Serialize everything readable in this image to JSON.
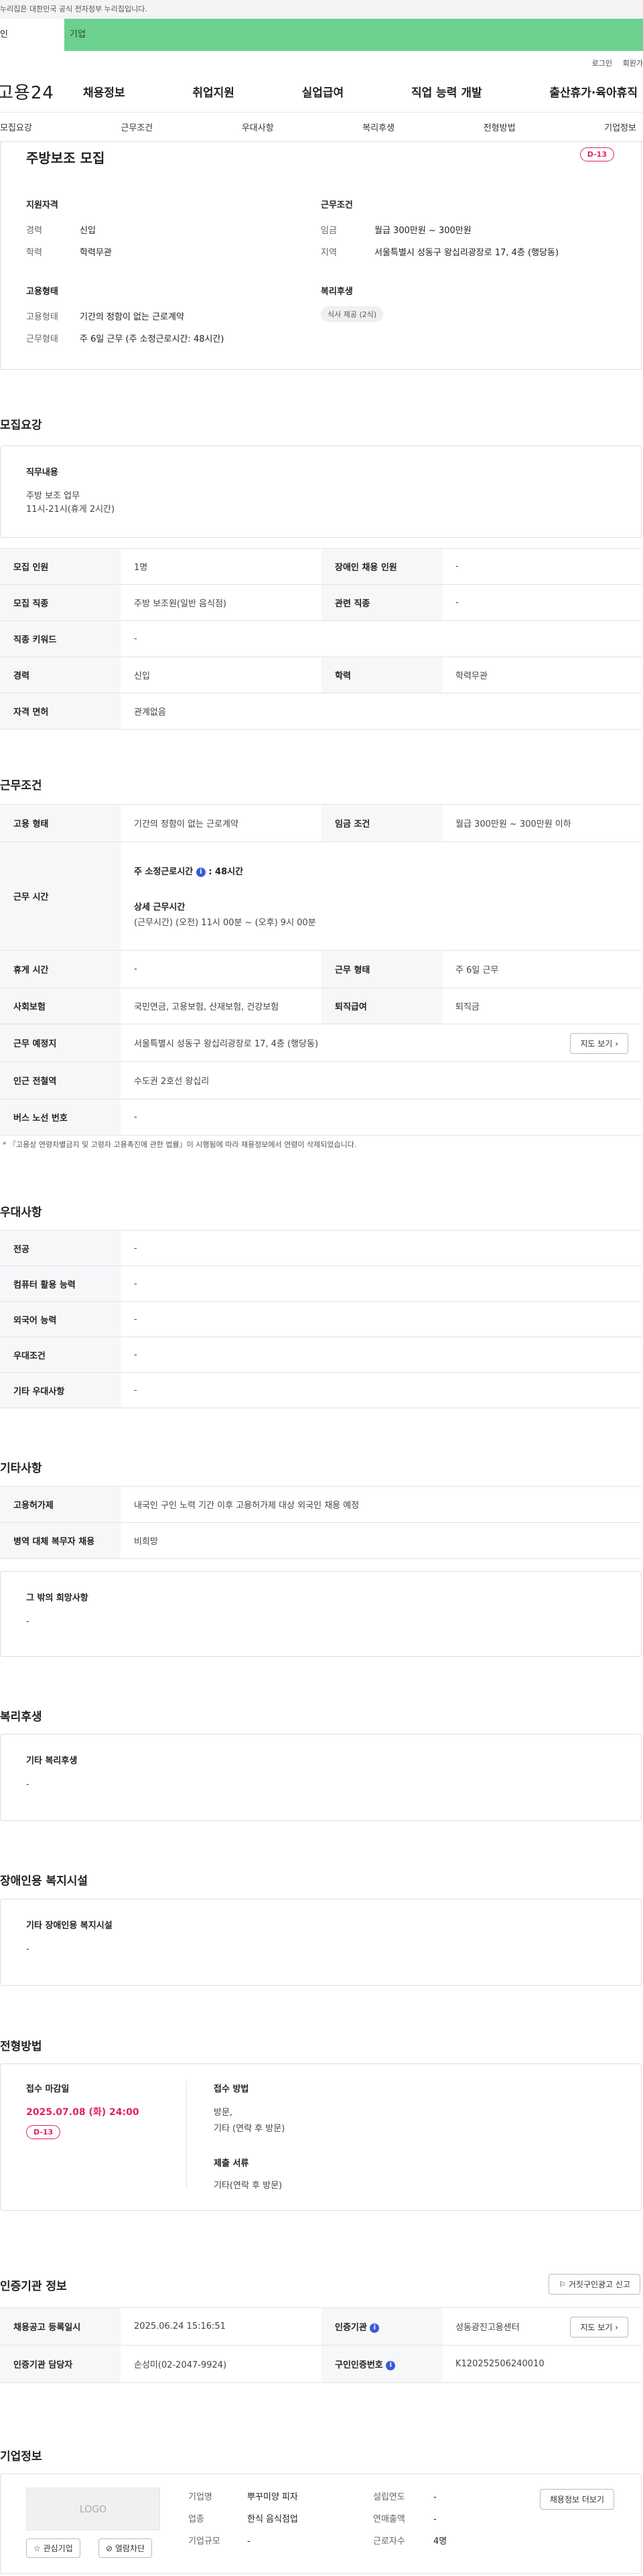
{
  "gov_banner": "누리집은 대한민국 공식 전자정부 누리집입니다.",
  "persona": {
    "individual": "인",
    "company": "기업"
  },
  "util": {
    "login": "로그인",
    "join": "회원가"
  },
  "gnb": {
    "logo": "고용24",
    "menu": [
      "채용정보",
      "취업지원",
      "실업급여",
      "직업 능력 개발",
      "출산휴가·육아휴직"
    ]
  },
  "tabs": [
    "모집요강",
    "근무조건",
    "우대사항",
    "복리후생",
    "전형방법",
    "기업정보"
  ],
  "summary": {
    "title": "주방보조 모집",
    "dday": "D-13",
    "qual_title": "지원자격",
    "qual": [
      {
        "k": "경력",
        "v": "신입"
      },
      {
        "k": "학력",
        "v": "학력무관"
      }
    ],
    "cond_title": "근무조건",
    "cond": [
      {
        "k": "임금",
        "v": "월급 300만원 ~ 300만원"
      },
      {
        "k": "지역",
        "v": "서울특별시 성동구 왕십리광장로 17, 4층 (행당동)"
      }
    ],
    "emp_title": "고용형태",
    "emp": [
      {
        "k": "고용형태",
        "v": "기간의 정함이 없는 근로계약"
      },
      {
        "k": "근무형태",
        "v": "주 6일 근무 (주 소정근로시간: 48시간)"
      }
    ],
    "welfare_title": "복리후생",
    "welfare_chip": "식사 제공 (2식)"
  },
  "recruit": {
    "title": "모집요강",
    "duty_title": "직무내용",
    "duty_lines": [
      "주방 보조 업무",
      "11시-21시(휴게 2시간)"
    ],
    "rows": {
      "count_k": "모집 인원",
      "count_v": "1명",
      "disabled_k": "장애인 채용 인원",
      "disabled_v": "-",
      "job_k": "모집 직종",
      "job_v": "주방 보조원(일반 음식점)",
      "related_k": "관련 직종",
      "related_v": "-",
      "kw_k": "직종 키워드",
      "kw_v": "-",
      "career_k": "경력",
      "career_v": "신입",
      "edu_k": "학력",
      "edu_v": "학력무관",
      "license_k": "자격 면허",
      "license_v": "관계없음"
    }
  },
  "work": {
    "title": "근무조건",
    "type_k": "고용 형태",
    "type_v": "기간의 정함이 없는 근로계약",
    "wage_k": "임금 조건",
    "wage_v": "월급 300만원 ~ 300만원 이하",
    "hours_k": "근무 시간",
    "hours_weekly": "주 소정근로시간",
    "hours_weekly_val": ": 48시간",
    "hours_detail_title": "상세 근무시간",
    "hours_detail": "(근무시간) (오전) 11시 00분 ~ (오후) 9시 00분",
    "rest_k": "휴게 시간",
    "rest_v": "-",
    "form_k": "근무 형태",
    "form_v": "주 6일 근무",
    "ins_k": "사회보험",
    "ins_v": "국민연금, 고용보험, 산재보험, 건강보험",
    "sev_k": "퇴직급여",
    "sev_v": "퇴직금",
    "place_k": "근무 예정지",
    "place_v": "서울특별시 성동구 왕십리광장로 17, 4층 (행당동)",
    "map_btn": "지도 보기",
    "subway_k": "인근 전철역",
    "subway_v": "수도권 2호선 왕십리",
    "bus_k": "버스 노선 번호",
    "bus_v": "-",
    "notice": "* 『고용상 연령차별금지 및 고령자 고용촉진에 관한 법률』이 시행됨에 따라 채용정보에서 연령이 삭제되었습니다."
  },
  "pref": {
    "title": "우대사항",
    "rows": [
      {
        "k": "전공",
        "v": "-"
      },
      {
        "k": "컴퓨터 활용 능력",
        "v": "-"
      },
      {
        "k": "외국어 능력",
        "v": "-"
      },
      {
        "k": "우대조건",
        "v": "-"
      },
      {
        "k": "기타 우대사항",
        "v": "-"
      }
    ]
  },
  "etc": {
    "title": "기타사항",
    "rows": [
      {
        "k": "고용허가제",
        "v": "내국인 구인 노력 기간 이후 고용허가제 대상 외국인 채용 예정"
      },
      {
        "k": "병역 대체 복무자 채용",
        "v": "비희망"
      }
    ],
    "other_title": "그 밖의 희망사항",
    "other_v": "-"
  },
  "welfare": {
    "title": "복리후생",
    "box_title": "기타 복리후생",
    "box_v": "-"
  },
  "facility": {
    "title": "장애인용 복지시설",
    "box_title": "기타 장애인용 복지시설",
    "box_v": "-"
  },
  "process": {
    "title": "전형방법",
    "deadline_title": "접수 마감일",
    "deadline": "2025.07.08 (화) 24:00",
    "dday": "D-13",
    "method_title": "접수 방법",
    "method_lines": [
      "방문,",
      "기타 (연락 후 방문)"
    ],
    "docs_title": "제출 서류",
    "docs": "기타(연락 후 방문)"
  },
  "cert": {
    "title": "인증기관 정보",
    "report_btn": "거짓구인광고 신고",
    "reg_k": "채용공고 등록일시",
    "reg_v": "2025.06.24 15:16:51",
    "org_k": "인증기관",
    "org_v": "성동광진고용센터",
    "map_btn": "지도 보기",
    "mgr_k": "인증기관 담당자",
    "mgr_v": "손성미(02-2047-9924)",
    "num_k": "구인인증번호",
    "num_v": "K120252506240010"
  },
  "company": {
    "title": "기업정보",
    "logo": "LOGO",
    "fav_btn": "관심기업",
    "block_btn": "열람차단",
    "name_k": "기업명",
    "name_v": "뿌꾸미양 피자",
    "year_k": "설립연도",
    "year_v": "-",
    "ind_k": "업종",
    "ind_v": "한식 음식점업",
    "sales_k": "연매출액",
    "sales_v": "-",
    "size_k": "기업규모",
    "size_v": "-",
    "emp_k": "근로자수",
    "emp_v": "4명",
    "jobs_btn": "채용정보 더보기"
  },
  "colors": {
    "accent_green": "#6cd08e",
    "dday_red": "#e0245e",
    "info_blue": "#3b5bdb"
  }
}
